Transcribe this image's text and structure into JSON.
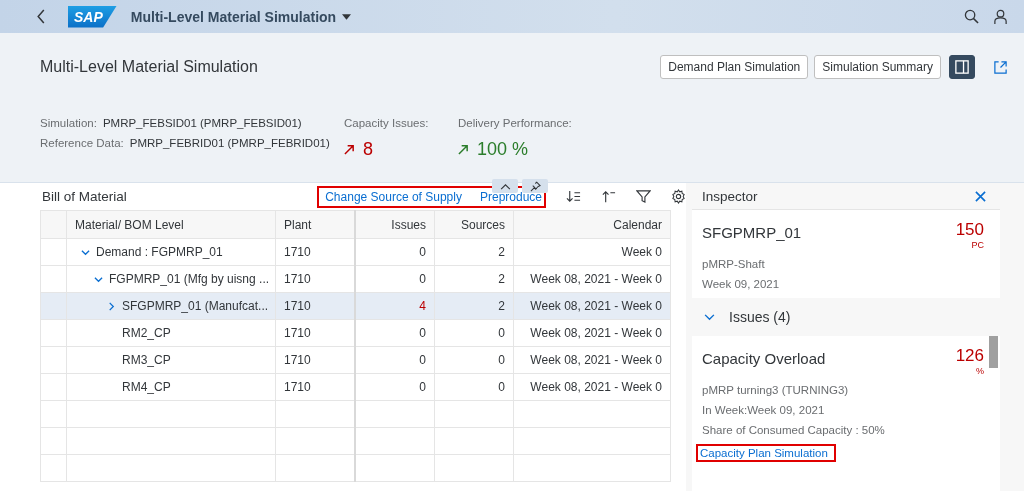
{
  "shell": {
    "logo": "SAP",
    "title": "Multi-Level Material Simulation"
  },
  "header": {
    "title": "Multi-Level Material Simulation",
    "buttons": [
      {
        "label": "Demand Plan Simulation"
      },
      {
        "label": "Simulation Summary"
      }
    ],
    "side_panel_toggle": {
      "selected": true
    },
    "attributes": [
      {
        "label": "Simulation:",
        "value": "PMRP_FEBSID01 (PMRP_FEBSID01)"
      },
      {
        "label": "Reference Data:",
        "value": "PMRP_FEBRID01 (PMRP_FEBRID01)"
      }
    ],
    "kpis": [
      {
        "label": "Capacity Issues:",
        "value": "8",
        "color": "#bb0000"
      },
      {
        "label": "Delivery Performance:",
        "value": "100 %",
        "color": "#2b7d2b"
      }
    ]
  },
  "table": {
    "title": "Bill of Material",
    "actions": [
      {
        "label": "Change Source of Supply"
      },
      {
        "label": "Preproduce"
      }
    ],
    "actions_highlighted": true,
    "columns": [
      "Material/ BOM Level",
      "Plant",
      "Issues",
      "Sources",
      "Calendar"
    ],
    "rows": [
      {
        "label": "Demand : FGPMRP_01",
        "plant": "1710",
        "issues": "0",
        "issue_alert": false,
        "sources": "2",
        "calendar": "Week 0",
        "expanded": true,
        "selected": false,
        "children": [
          {
            "label": "FGPMRP_01 (Mfg by uisng ...",
            "plant": "1710",
            "issues": "0",
            "issue_alert": false,
            "sources": "2",
            "calendar": "Week 08, 2021 - Week 0",
            "expanded": true,
            "selected": false,
            "children": [
              {
                "label": "SFGPMRP_01 (Manufcat...",
                "plant": "1710",
                "issues": "4",
                "issue_alert": true,
                "sources": "2",
                "calendar": "Week 08, 2021 - Week 0",
                "expanded": false,
                "selected": true
              },
              {
                "label": "RM2_CP",
                "plant": "1710",
                "issues": "0",
                "issue_alert": false,
                "sources": "0",
                "calendar": "Week 08, 2021 - Week 0",
                "selected": false
              },
              {
                "label": "RM3_CP",
                "plant": "1710",
                "issues": "0",
                "issue_alert": false,
                "sources": "0",
                "calendar": "Week 08, 2021 - Week 0",
                "selected": false
              },
              {
                "label": "RM4_CP",
                "plant": "1710",
                "issues": "0",
                "issue_alert": false,
                "sources": "0",
                "calendar": "Week 08, 2021 - Week 0",
                "selected": false
              }
            ]
          }
        ]
      }
    ]
  },
  "inspector": {
    "title": "Inspector",
    "item": {
      "name": "SFGPMRP_01",
      "quantity": "150",
      "unit": "PC",
      "description": "pMRP-Shaft",
      "week": "Week 09, 2021"
    },
    "issues_section": {
      "label": "Issues (4)",
      "expanded": true
    },
    "issue": {
      "title": "Capacity Overload",
      "value": "126",
      "unit": "%",
      "lines": [
        "pMRP turning3 (TURNING3)",
        "In Week:Week 09, 2021",
        "Share of Consumed Capacity : 50%"
      ],
      "link": "Capacity Plan Simulation",
      "link_highlighted": true
    }
  }
}
